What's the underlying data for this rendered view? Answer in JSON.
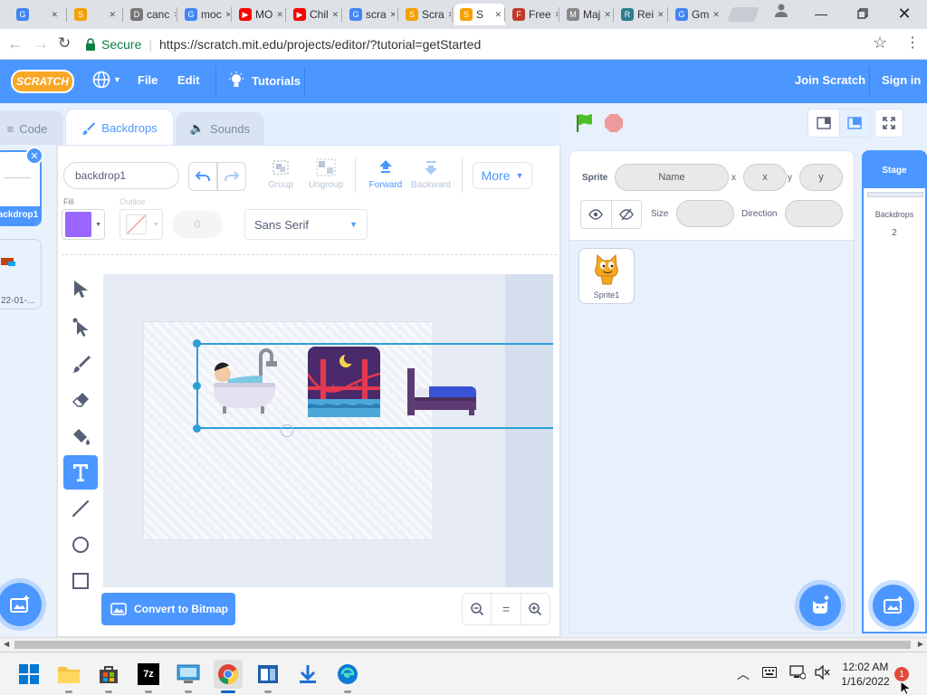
{
  "browser": {
    "tabs": [
      {
        "label": "",
        "color": "#4285f4",
        "glyph": "G"
      },
      {
        "label": "",
        "color": "#f4a000",
        "glyph": "S"
      },
      {
        "label": "canc",
        "color": "#777",
        "glyph": "D"
      },
      {
        "label": "moc",
        "color": "#4285f4",
        "glyph": "G"
      },
      {
        "label": "MO",
        "color": "#ff0000",
        "glyph": "▶"
      },
      {
        "label": "Chil",
        "color": "#ff0000",
        "glyph": "▶"
      },
      {
        "label": "scra",
        "color": "#4285f4",
        "glyph": "G"
      },
      {
        "label": "Scra",
        "color": "#f4a000",
        "glyph": "S"
      },
      {
        "label": "S",
        "color": "#f4a000",
        "glyph": "S"
      },
      {
        "label": "Free",
        "color": "#c0392b",
        "glyph": "F"
      },
      {
        "label": "Maj",
        "color": "#888",
        "glyph": "M"
      },
      {
        "label": "Rei",
        "color": "#2e7d8a",
        "glyph": "R"
      },
      {
        "label": "Gm",
        "color": "#4285f4",
        "glyph": "G"
      }
    ],
    "secure_label": "Secure",
    "url": "https://scratch.mit.edu/projects/editor/?tutorial=getStarted"
  },
  "menubar": {
    "logo": "SCRATCH",
    "file": "File",
    "edit": "Edit",
    "tutorials": "Tutorials",
    "join": "Join Scratch",
    "signin": "Sign in"
  },
  "editor_tabs": {
    "code": "Code",
    "backdrops": "Backdrops",
    "sounds": "Sounds"
  },
  "backdrop_list": [
    {
      "label": "ackdrop1"
    },
    {
      "label": "22-01-..."
    }
  ],
  "paint": {
    "costume_name": "backdrop1",
    "group": "Group",
    "ungroup": "Ungroup",
    "forward": "Forward",
    "backward": "Backward",
    "more": "More",
    "fill_label": "Fill",
    "outline_label": "Outline",
    "outline_width": "0",
    "font": "Sans Serif",
    "fill_color": "#9966ff",
    "convert": "Convert to Bitmap",
    "zoom_reset": "="
  },
  "sprite_info": {
    "sprite_label": "Sprite",
    "name_placeholder": "Name",
    "x_label": "x",
    "x_placeholder": "x",
    "y_label": "y",
    "y_placeholder": "y",
    "size_label": "Size",
    "direction_label": "Direction"
  },
  "sprites": [
    {
      "name": "Sprite1"
    }
  ],
  "stage_panel": {
    "title": "Stage",
    "backdrops_label": "Backdrops",
    "backdrops_count": "2"
  },
  "taskbar": {
    "time": "12:02 AM",
    "date": "1/16/2022",
    "notifications": "1"
  }
}
